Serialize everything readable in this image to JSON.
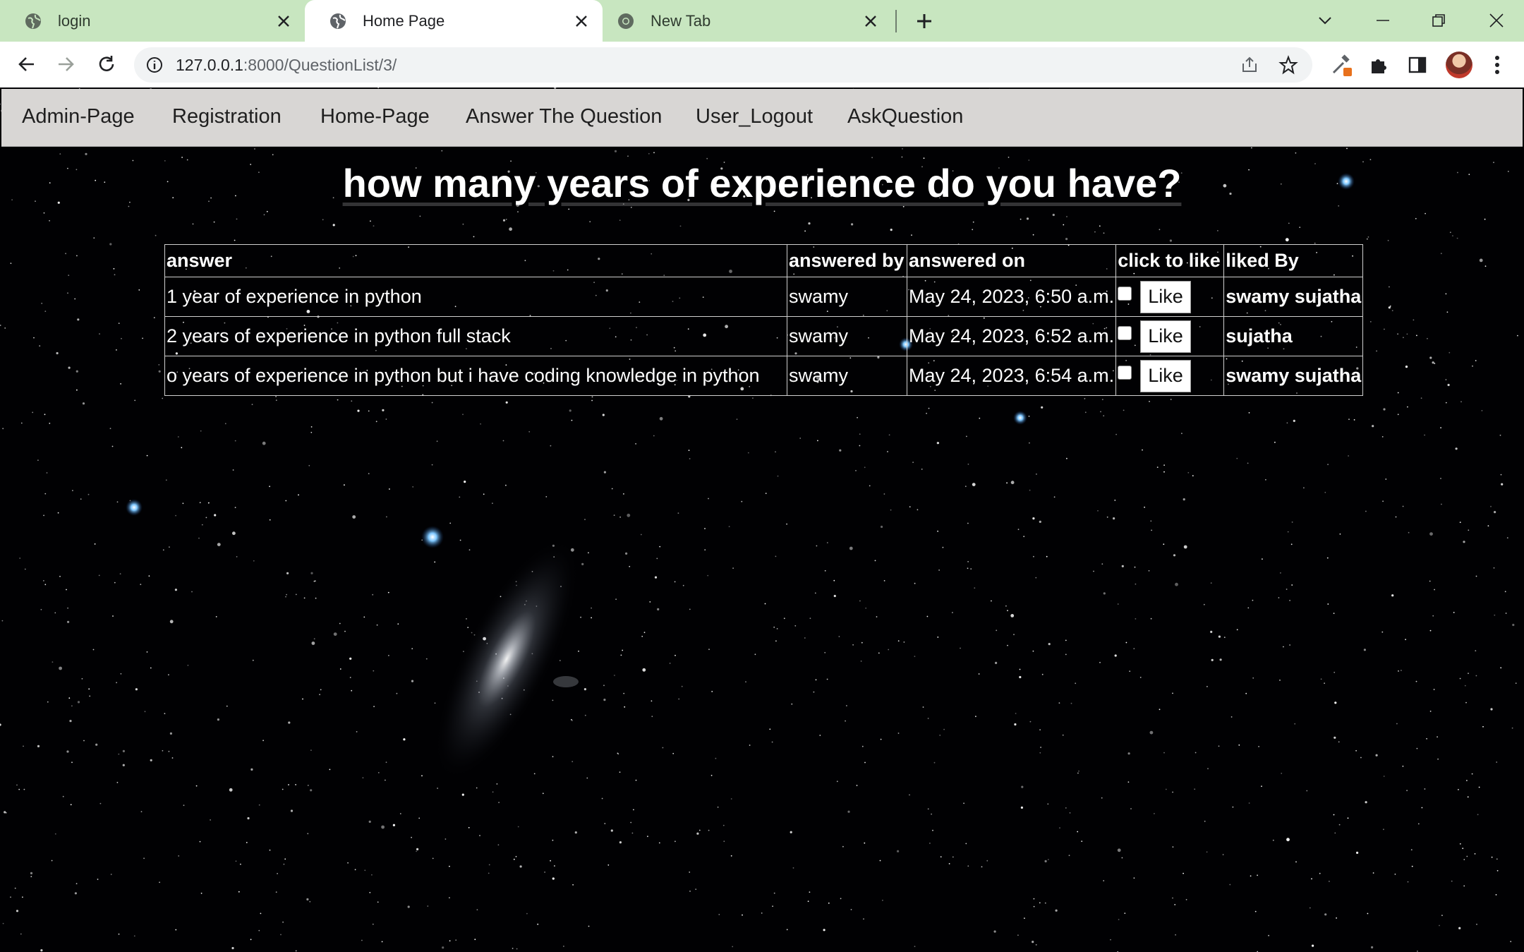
{
  "browser": {
    "tabs": [
      {
        "title": "login",
        "active": false
      },
      {
        "title": "Home Page",
        "active": true
      },
      {
        "title": "New Tab",
        "active": false
      }
    ],
    "url_host": "127.0.0.1",
    "url_path": ":8000/QuestionList/3/"
  },
  "site_nav": {
    "items": [
      "Admin-Page",
      "Registration",
      "Home-Page",
      "Answer The Question",
      "User_Logout",
      "AskQuestion"
    ]
  },
  "question": {
    "title": "how many years of experience do you have?"
  },
  "answers_table": {
    "headers": [
      "answer",
      "answered by",
      "answered on",
      "click to like",
      "liked By"
    ],
    "like_label": "Like",
    "rows": [
      {
        "answer": "1 year of experience in python",
        "answered_by": "swamy",
        "answered_on": "May 24, 2023, 6:50 a.m.",
        "liked_by": "swamy sujatha",
        "checked": false
      },
      {
        "answer": "2 years of experience in python full stack",
        "answered_by": "swamy",
        "answered_on": "May 24, 2023, 6:52 a.m.",
        "liked_by": "sujatha",
        "checked": false
      },
      {
        "answer": "o years of experience in python but i have coding knowledge in python",
        "answered_by": "swamy",
        "answered_on": "May 24, 2023, 6:54 a.m.",
        "liked_by": "swamy sujatha",
        "checked": false
      }
    ]
  },
  "colors": {
    "tabstrip": "#c8e6c0",
    "nav_bar": "#d8d6d4",
    "page_background": "#010103"
  }
}
